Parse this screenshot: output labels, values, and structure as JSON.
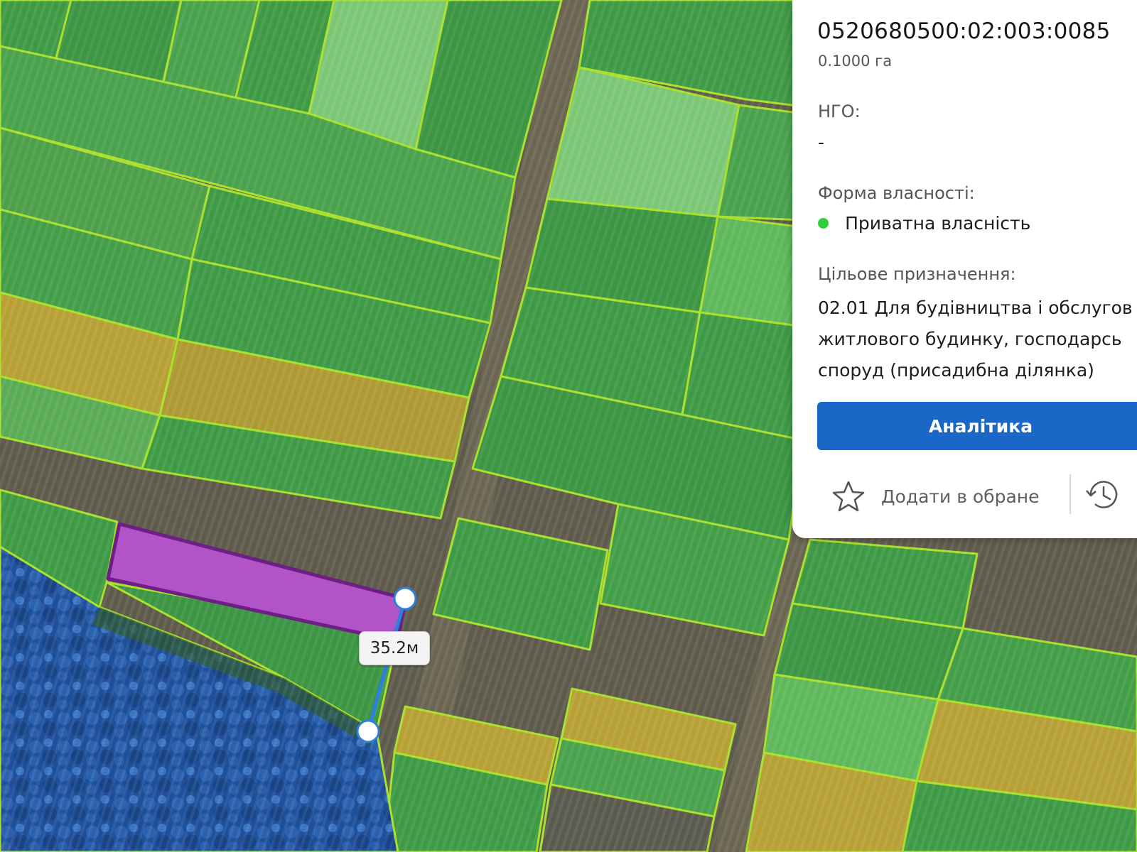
{
  "map": {
    "measurement_label": "35.2м",
    "colors": {
      "field_green": "#3f9a45",
      "field_yellow": "#b7a035",
      "forest_blue": "#1e4f9a",
      "parcel_border": "#a8e02a",
      "selected_parcel_fill": "#b154c8",
      "selected_parcel_border": "#6d1f85",
      "measure_line": "#2e7fe0"
    }
  },
  "panel": {
    "cadastral_number": "0520680500:02:003:0085",
    "area": "0.1000 га",
    "ngo_label": "НГО:",
    "ngo_value": "-",
    "ownership_label": "Форма власності:",
    "ownership_value": "Приватна власність",
    "ownership_status_color": "#2fcf3a",
    "purpose_label": "Цільове призначення:",
    "purpose_lines": [
      "02.01 Для будівництва і обслугов",
      "житлового будинку, господарсь",
      "споруд (присадибна ділянка)"
    ],
    "analytics_button": "Аналітика",
    "favorite_label": "Додати в обране",
    "favorite_icon": "star-icon",
    "history_icon": "history-icon",
    "accent_color": "#1a67c8"
  }
}
